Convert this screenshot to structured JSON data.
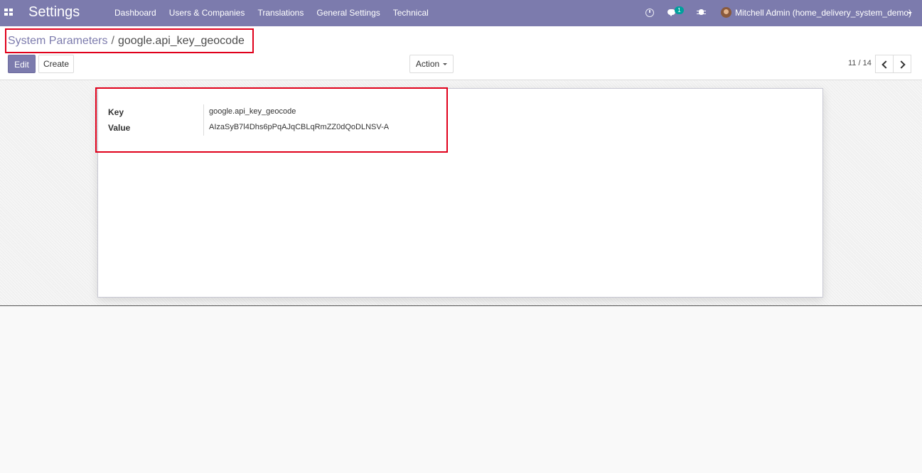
{
  "navbar": {
    "app_title": "Settings",
    "menu": [
      "Dashboard",
      "Users & Companies",
      "Translations",
      "General Settings",
      "Technical"
    ],
    "chat_badge": "1",
    "user": "Mitchell Admin (home_delivery_system_demo)",
    "icons": [
      "apps-icon",
      "clock-icon",
      "chat-icon",
      "bug-icon",
      "avatar"
    ],
    "color": "#7c7bad"
  },
  "breadcrumb": {
    "parent": "System Parameters",
    "separator": "/",
    "current": "google.api_key_geocode"
  },
  "buttons": {
    "edit": "Edit",
    "create": "Create",
    "action": "Action"
  },
  "pager": {
    "value": "11 / 14"
  },
  "form": {
    "key_label": "Key",
    "key_value": "google.api_key_geocode",
    "value_label": "Value",
    "value_value": "AIzaSyB7l4Dhs6pPqAJqCBLqRmZZ0dQoDLNSV-A"
  },
  "highlight_color": "#e0001b"
}
